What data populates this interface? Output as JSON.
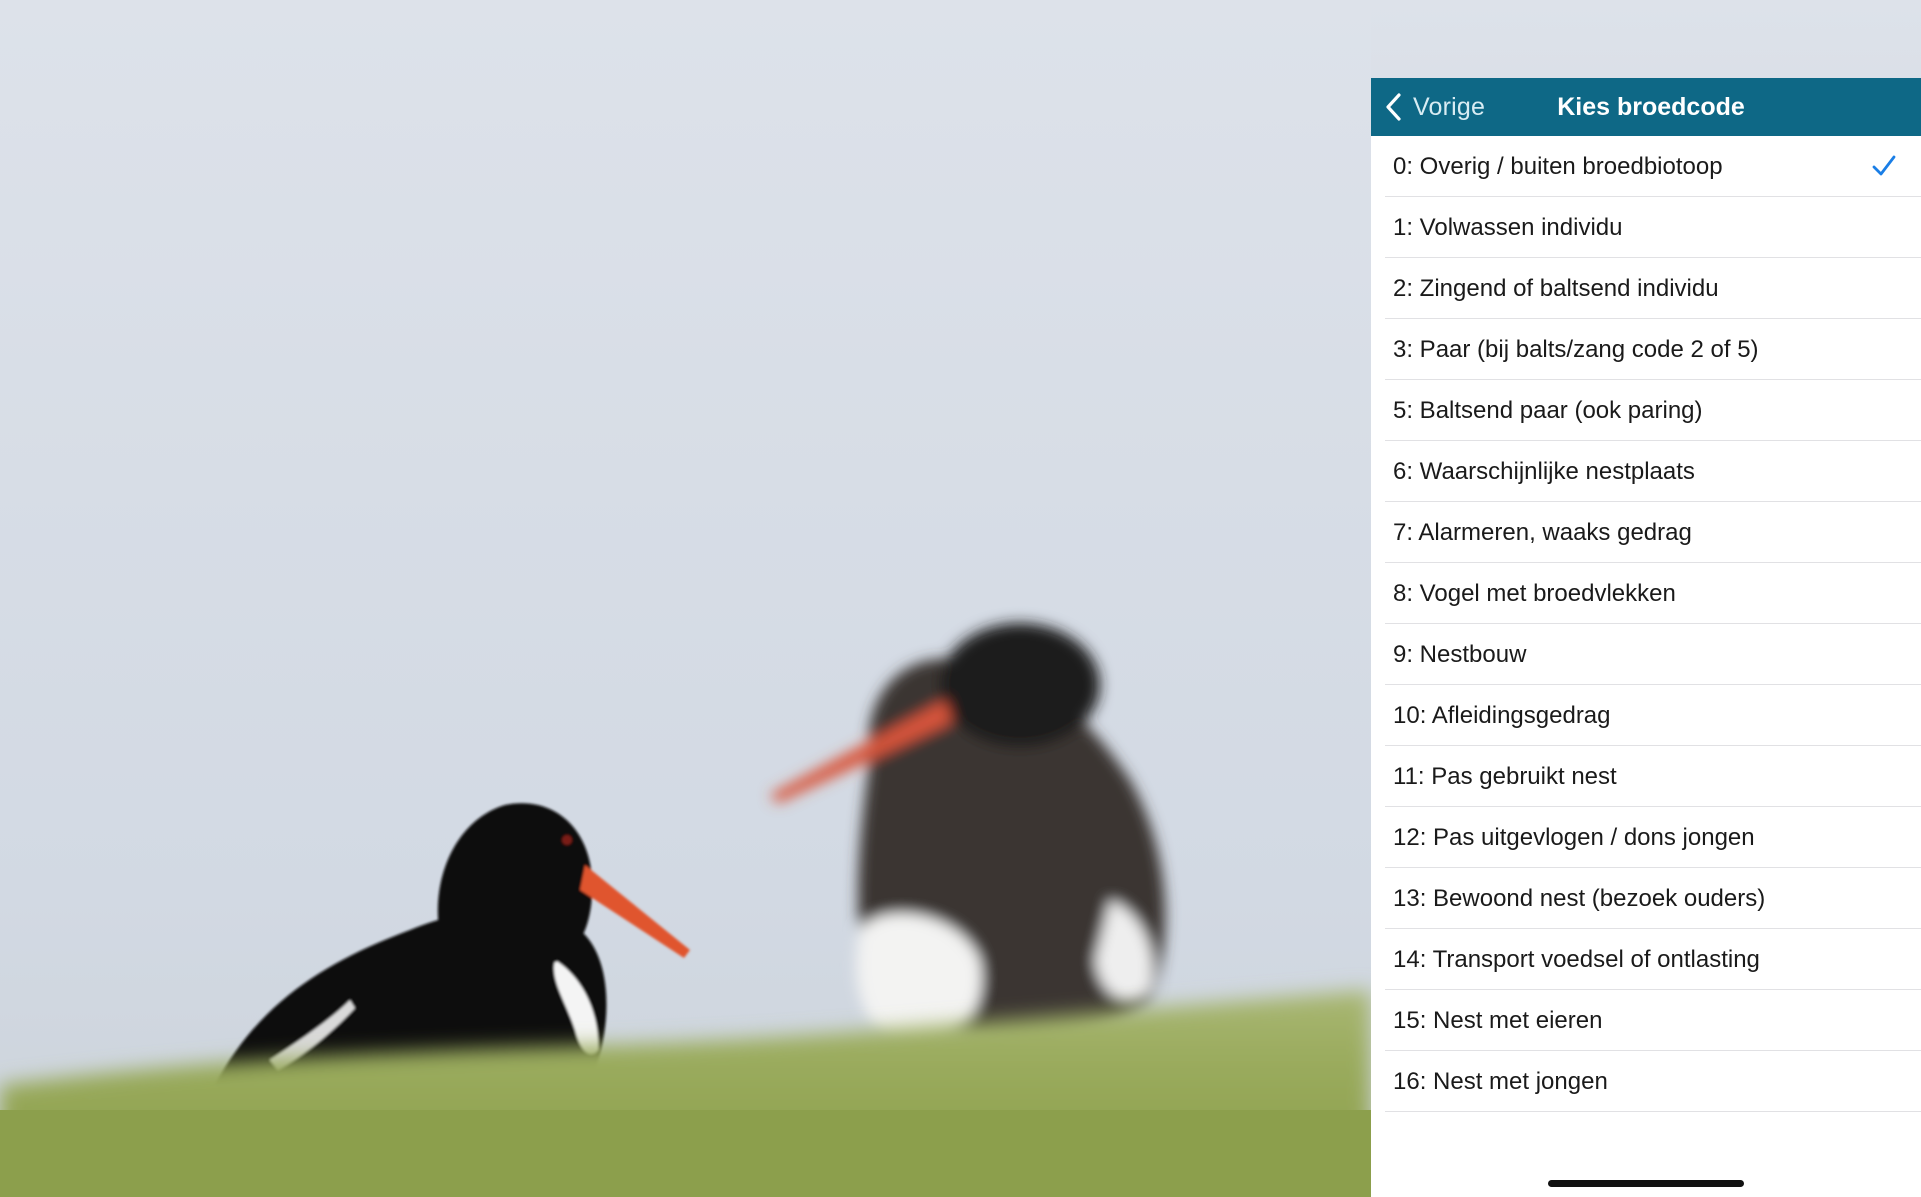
{
  "navbar": {
    "back_label": "Vorige",
    "title": "Kies broedcode",
    "background": "#0e6886",
    "back_icon": "chevron-left-icon"
  },
  "list": {
    "selected_index": 0,
    "check_color": "#1a7ee6",
    "check_icon": "checkmark-icon",
    "items": [
      "0: Overig / buiten broedbiotoop",
      "1: Volwassen individu",
      "2: Zingend of baltsend individu",
      "3: Paar (bij balts/zang code 2 of 5)",
      "5: Baltsend paar (ook paring)",
      "6: Waarschijnlijke nestplaats",
      "7: Alarmeren, waaks gedrag",
      "8: Vogel met broedvlekken",
      "9: Nestbouw",
      "10: Afleidingsgedrag",
      "11: Pas gebruikt nest",
      "12: Pas uitgevlogen / dons jongen",
      "13: Bewoond nest (bezoek ouders)",
      "14: Transport voedsel of ontlasting",
      "15: Nest met eieren",
      "16: Nest met jongen"
    ]
  }
}
